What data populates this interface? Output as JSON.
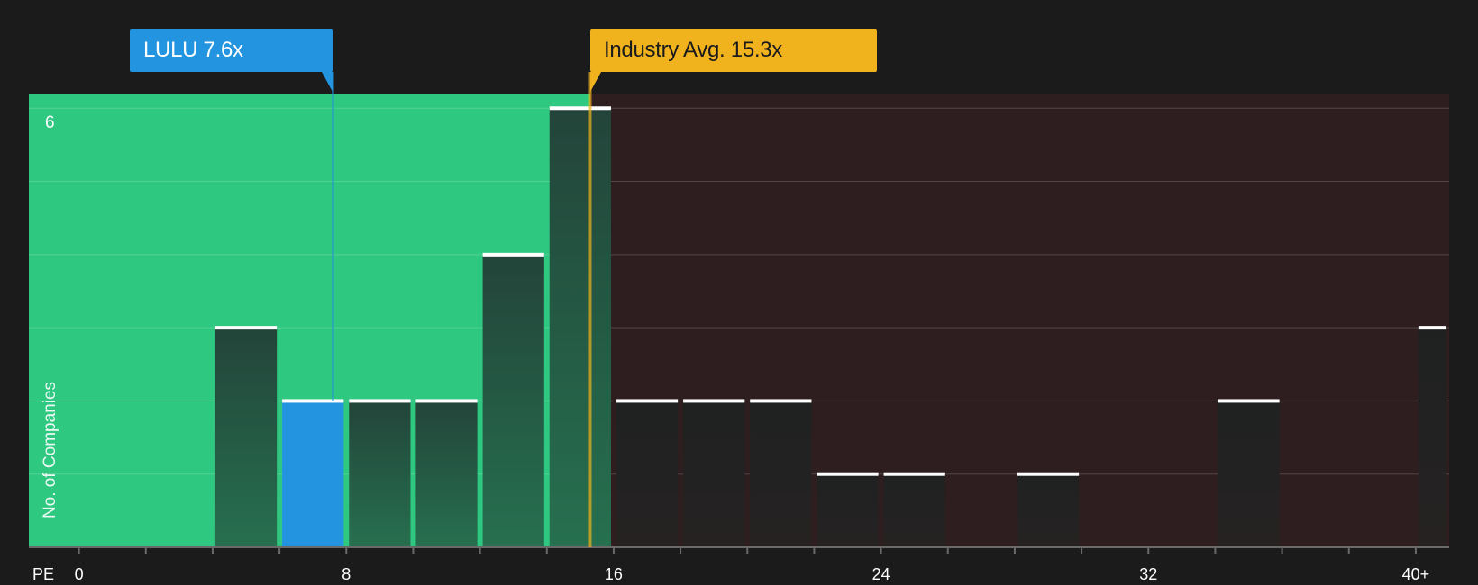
{
  "chart_data": {
    "type": "bar",
    "metric": "PE",
    "xlabel": "PE",
    "ylabel": "No. of Companies",
    "xlim": [
      -1.5,
      41
    ],
    "ylim": [
      0,
      6.2
    ],
    "x_ticks": [
      0,
      8,
      16,
      24,
      32,
      40
    ],
    "x_tick_labels": [
      "0",
      "8",
      "16",
      "24",
      "32",
      "40+"
    ],
    "y_tick_labels_shown": [
      "6"
    ],
    "y_gridlines": [
      1,
      2,
      3,
      4,
      5,
      6
    ],
    "bin_width": 2,
    "bins": [
      {
        "start": 4,
        "end": 6,
        "count": 3
      },
      {
        "start": 6,
        "end": 8,
        "count": 2,
        "highlight": true
      },
      {
        "start": 8,
        "end": 10,
        "count": 2
      },
      {
        "start": 10,
        "end": 12,
        "count": 2
      },
      {
        "start": 12,
        "end": 14,
        "count": 4
      },
      {
        "start": 14,
        "end": 16,
        "count": 6
      },
      {
        "start": 16,
        "end": 18,
        "count": 2
      },
      {
        "start": 18,
        "end": 20,
        "count": 2
      },
      {
        "start": 20,
        "end": 22,
        "count": 2
      },
      {
        "start": 22,
        "end": 24,
        "count": 1
      },
      {
        "start": 24,
        "end": 26,
        "count": 1
      },
      {
        "start": 28,
        "end": 30,
        "count": 1
      },
      {
        "start": 34,
        "end": 36,
        "count": 2
      },
      {
        "start": 40,
        "end": 42,
        "count": 3
      }
    ],
    "company": {
      "ticker": "LULU",
      "value": 7.6,
      "label": "LULU 7.6x",
      "color": "#2394e0"
    },
    "industry": {
      "label": "Industry Avg. 15.3x",
      "value": 15.3,
      "color": "#f0b31e"
    },
    "undervalued_zone": {
      "from": -1.5,
      "to": 15.3,
      "color": "#2ec880"
    },
    "overvalued_zone": {
      "from": 15.3,
      "to": 41,
      "color": "#2e1e20"
    }
  }
}
